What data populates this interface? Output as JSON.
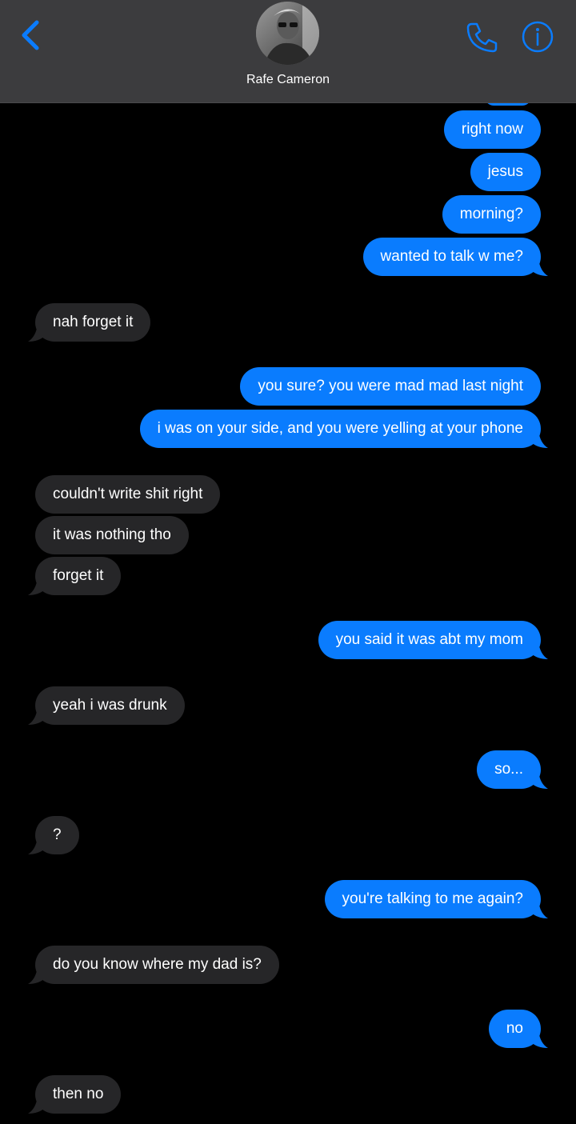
{
  "header": {
    "contact_name": "Rafe Cameron",
    "back_icon": "chevron-left-icon",
    "phone_icon": "phone-icon",
    "info_icon": "info-icon",
    "accent_color": "#0a7cfe",
    "header_bg": "#3c3c3e"
  },
  "colors": {
    "outgoing_bubble": "#0a7cfe",
    "incoming_bubble": "#262628",
    "background": "#000000"
  },
  "messages": [
    {
      "from": "me",
      "text": "right now"
    },
    {
      "from": "me",
      "text": "jesus"
    },
    {
      "from": "me",
      "text": "morning?"
    },
    {
      "from": "me",
      "text": "wanted to talk w me?"
    },
    {
      "from": "them",
      "text": "nah forget it"
    },
    {
      "from": "me",
      "text": "you sure? you were mad mad last night"
    },
    {
      "from": "me",
      "text": "i was on your side, and you were yelling at your phone"
    },
    {
      "from": "them",
      "text": "couldn't write shit right"
    },
    {
      "from": "them",
      "text": "it was nothing tho"
    },
    {
      "from": "them",
      "text": "forget it"
    },
    {
      "from": "me",
      "text": "you said it was abt my mom"
    },
    {
      "from": "them",
      "text": "yeah i was drunk"
    },
    {
      "from": "me",
      "text": "so..."
    },
    {
      "from": "them",
      "text": "?"
    },
    {
      "from": "me",
      "text": "you're talking to me again?"
    },
    {
      "from": "them",
      "text": "do you know where my dad is?"
    },
    {
      "from": "me",
      "text": "no"
    },
    {
      "from": "them",
      "text": "then no"
    }
  ]
}
